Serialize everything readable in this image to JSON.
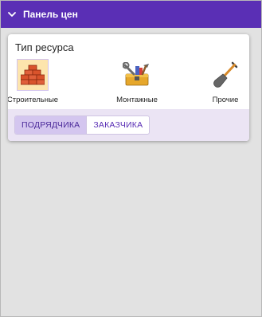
{
  "panel": {
    "title": "Панель цен",
    "collapse_icon": "chevron-down-icon",
    "header_color": "#5a2fb5"
  },
  "card": {
    "title": "Тип ресурса",
    "resources": [
      {
        "label": "Строительные",
        "icon": "bricks-icon",
        "selected": true
      },
      {
        "label": "Монтажные",
        "icon": "toolbox-icon",
        "selected": false
      },
      {
        "label": "Прочие",
        "icon": "shovel-icon",
        "selected": false
      }
    ],
    "toggle": {
      "options": [
        "ПОДРЯДЧИКА",
        "ЗАКАЗЧИКА"
      ],
      "active": "ПОДРЯДЧИКА"
    }
  },
  "colors": {
    "accent": "#5a2fb5",
    "selected_bg": "#fde5ad",
    "tabs_bg": "#ebe4f4",
    "active_toggle_bg": "#d4c6ef"
  }
}
